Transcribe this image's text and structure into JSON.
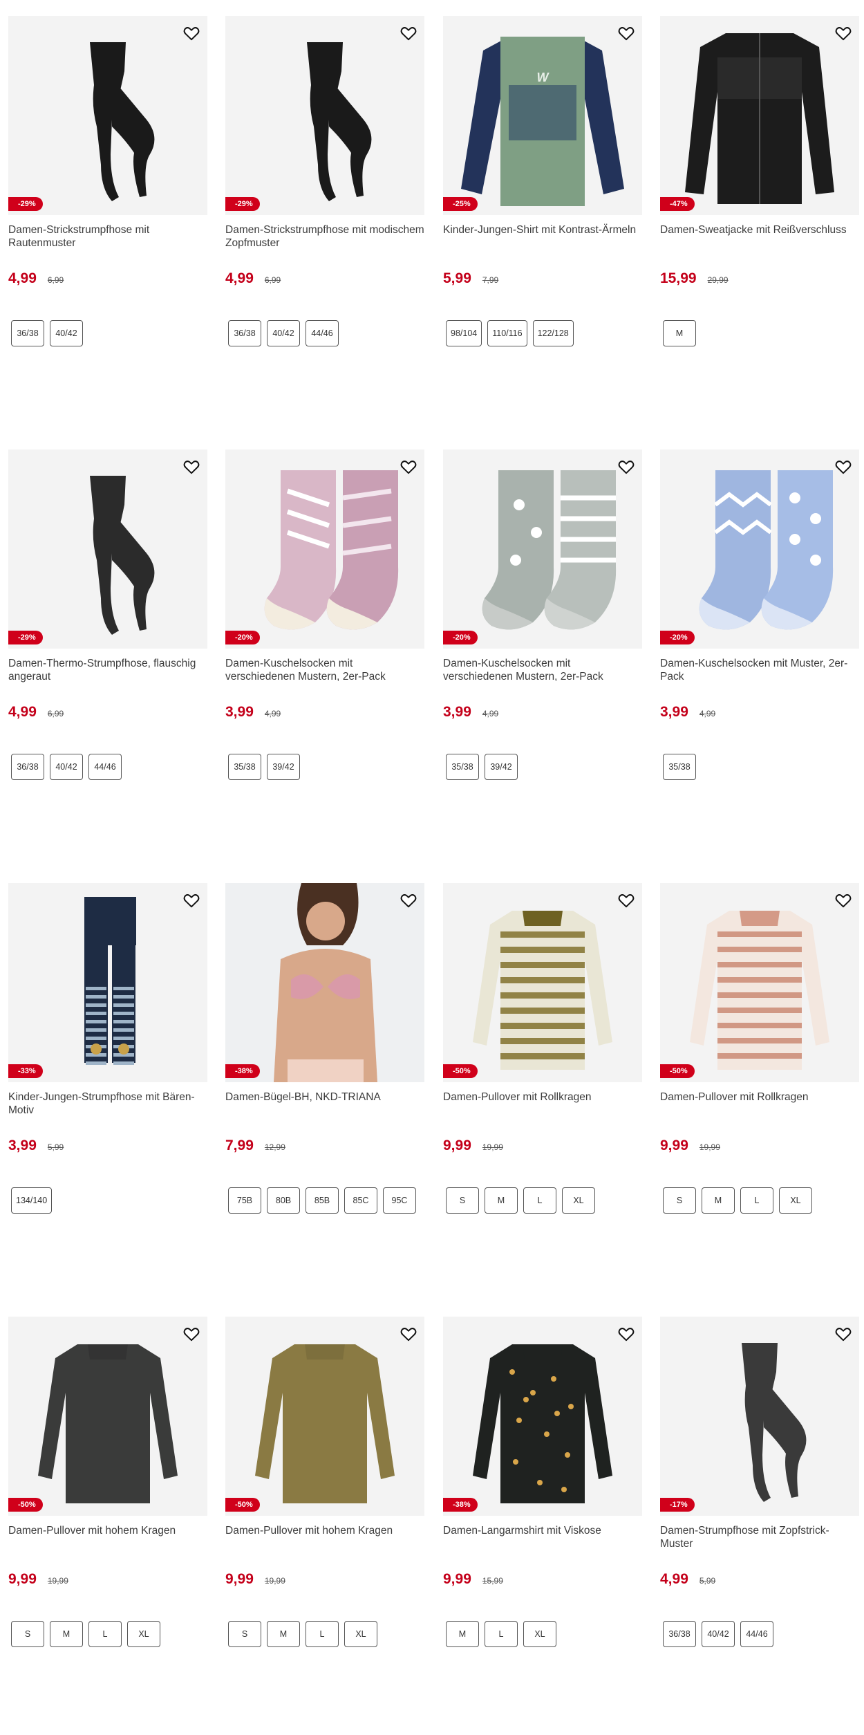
{
  "colors": {
    "accent": "#d0001a",
    "price": "#c4001a",
    "image_bg": "#f3f3f3"
  },
  "products": [
    {
      "title": "Damen-Strickstrumpfhose mit Rautenmuster",
      "price": "4,99",
      "old_price": "6,99",
      "discount": "-29%",
      "sizes": [
        "36/38",
        "40/42"
      ],
      "image": "tights-black"
    },
    {
      "title": "Damen-Strickstrumpfhose mit modischem Zopfmuster",
      "price": "4,99",
      "old_price": "6,99",
      "discount": "-29%",
      "sizes": [
        "36/38",
        "40/42",
        "44/46"
      ],
      "image": "tights-black"
    },
    {
      "title": "Kinder-Jungen-Shirt mit Kontrast-Ärmeln",
      "price": "5,99",
      "old_price": "7,99",
      "discount": "-25%",
      "sizes": [
        "98/104",
        "110/116",
        "122/128"
      ],
      "image": "shirt-green-navy"
    },
    {
      "title": "Damen-Sweatjacke mit Reißverschluss",
      "price": "15,99",
      "old_price": "29,99",
      "discount": "-47%",
      "sizes": [
        "M"
      ],
      "image": "jacket-black"
    },
    {
      "title": "Damen-Thermo-Strumpfhose, flauschig angeraut",
      "price": "4,99",
      "old_price": "6,99",
      "discount": "-29%",
      "sizes": [
        "36/38",
        "40/42",
        "44/46"
      ],
      "image": "tights-dark"
    },
    {
      "title": "Damen-Kuschelsocken mit verschiedenen Mustern, 2er-Pack",
      "price": "3,99",
      "old_price": "4,99",
      "discount": "-20%",
      "sizes": [
        "35/38",
        "39/42"
      ],
      "image": "socks-pink"
    },
    {
      "title": "Damen-Kuschelsocken mit verschiedenen Mustern, 2er-Pack",
      "price": "3,99",
      "old_price": "4,99",
      "discount": "-20%",
      "sizes": [
        "35/38",
        "39/42"
      ],
      "image": "socks-grey"
    },
    {
      "title": "Damen-Kuschelsocken mit Muster, 2er-Pack",
      "price": "3,99",
      "old_price": "4,99",
      "discount": "-20%",
      "sizes": [
        "35/38"
      ],
      "image": "socks-blue"
    },
    {
      "title": "Kinder-Jungen-Strumpfhose mit Bären-Motiv",
      "price": "3,99",
      "old_price": "5,99",
      "discount": "-33%",
      "sizes": [
        "134/140"
      ],
      "image": "tights-navy-stripes"
    },
    {
      "title": "Damen-Bügel-BH, NKD-TRIANA",
      "price": "7,99",
      "old_price": "12,99",
      "discount": "-38%",
      "sizes": [
        "75B",
        "80B",
        "85B",
        "85C",
        "95C"
      ],
      "image": "bra-model"
    },
    {
      "title": "Damen-Pullover mit Rollkragen",
      "price": "9,99",
      "old_price": "19,99",
      "discount": "-50%",
      "sizes": [
        "S",
        "M",
        "L",
        "XL"
      ],
      "image": "pullover-olive"
    },
    {
      "title": "Damen-Pullover mit Rollkragen",
      "price": "9,99",
      "old_price": "19,99",
      "discount": "-50%",
      "sizes": [
        "S",
        "M",
        "L",
        "XL"
      ],
      "image": "pullover-rust"
    },
    {
      "title": "Damen-Pullover mit hohem Kragen",
      "price": "9,99",
      "old_price": "19,99",
      "discount": "-50%",
      "sizes": [
        "S",
        "M",
        "L",
        "XL"
      ],
      "image": "sweater-charcoal"
    },
    {
      "title": "Damen-Pullover mit hohem Kragen",
      "price": "9,99",
      "old_price": "19,99",
      "discount": "-50%",
      "sizes": [
        "S",
        "M",
        "L",
        "XL"
      ],
      "image": "sweater-olive"
    },
    {
      "title": "Damen-Langarmshirt mit Viskose",
      "price": "9,99",
      "old_price": "15,99",
      "discount": "-38%",
      "sizes": [
        "M",
        "L",
        "XL"
      ],
      "image": "shirt-floral"
    },
    {
      "title": "Damen-Strumpfhose mit Zopfstrick-Muster",
      "price": "4,99",
      "old_price": "5,99",
      "discount": "-17%",
      "sizes": [
        "36/38",
        "40/42",
        "44/46"
      ],
      "image": "tights-charcoal"
    }
  ]
}
